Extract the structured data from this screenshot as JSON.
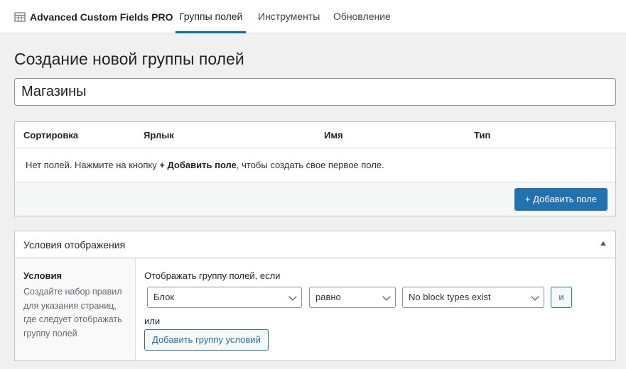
{
  "header": {
    "brand": "Advanced Custom Fields PRO",
    "brand_icon": "table-grid-icon",
    "tabs": [
      {
        "label": "Группы полей",
        "active": true
      },
      {
        "label": "Инструменты",
        "active": false
      },
      {
        "label": "Обновление",
        "active": false
      }
    ],
    "accent_color": "#0073aa"
  },
  "page": {
    "title": "Создание новой группы полей",
    "group_title_value": "Магазины"
  },
  "fields_table": {
    "columns": [
      "Сортировка",
      "Ярлык",
      "Имя",
      "Тип"
    ],
    "empty_message_before": "Нет полей. Нажмите на кнопку ",
    "empty_message_bold": "+ Добавить поле",
    "empty_message_after": ", чтобы создать свое первое поле.",
    "add_button": "+ Добавить поле",
    "button_color": "#2271b1"
  },
  "location": {
    "title": "Условия отображения",
    "toggle_icon": "triangle-up-icon",
    "side_label": "Условия",
    "side_description": "Создайте набор правил для указания страниц, где следует отображать группу полей",
    "rules_label": "Отображать группу полей, если",
    "rule": {
      "param": "Блок",
      "operator": "равно",
      "value": "No block types exist"
    },
    "and_button": "и",
    "or_label": "или",
    "add_group_button": "Добавить группу условий"
  }
}
